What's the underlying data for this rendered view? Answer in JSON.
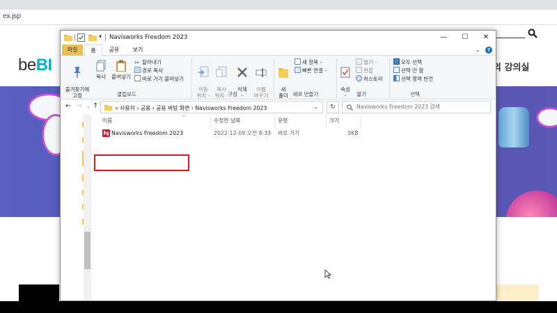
{
  "browser": {
    "url_fragment": "ex.jsp",
    "logo_prefix": "be",
    "logo_accent": "BI",
    "nav_text": "의 강의실",
    "accent_color": "#00b4c8"
  },
  "explorer": {
    "title": "Navisworks Freedom 2023",
    "tabs": {
      "file": "파일",
      "home": "홈",
      "share": "공유",
      "view": "보기"
    },
    "ribbon": {
      "pin": "즐겨찾기에\n고정",
      "copy": "복사",
      "paste": "붙여넣기",
      "cut": "잘라내기",
      "copy_path": "경로 복사",
      "paste_shortcut": "바로 가기 붙여넣기",
      "clipboard_group": "클립보드",
      "move_to": "이동\n위치 -",
      "copy_to": "복사\n위치 -",
      "delete": "삭제\n-",
      "rename": "이름\n바꾸기",
      "organize_group": "구성",
      "new_folder": "새\n폴더",
      "new_item": "새 항목 -",
      "easy_access": "빠른 연결 -",
      "new_group": "새로 만들기",
      "properties": "속성\n-",
      "open": "열기 -",
      "edit": "편집",
      "history": "히스토리",
      "open_group": "열기",
      "select_all": "모두 선택",
      "select_none": "선택 안 함",
      "invert_selection": "선택 영역 반전",
      "select_group": "선택"
    },
    "address": {
      "path": "«  사용자  ›  공용  ›  공용 바탕 화면  ›  Navisworks Freedom 2023",
      "search_placeholder": "Navisworks Freedom 2023 검색"
    },
    "columns": {
      "name": "이름",
      "date": "수정한 날짜",
      "type": "유형",
      "size": "크기"
    },
    "files": [
      {
        "name": "Navisworks Freedom 2023",
        "date": "2022-12-09 오전 8:33",
        "type": "바로 가기",
        "size": "3KB"
      }
    ],
    "colors": {
      "file_tab": "#e8c05a",
      "highlight": "#e3131b",
      "help": "#1a6fc9"
    }
  }
}
